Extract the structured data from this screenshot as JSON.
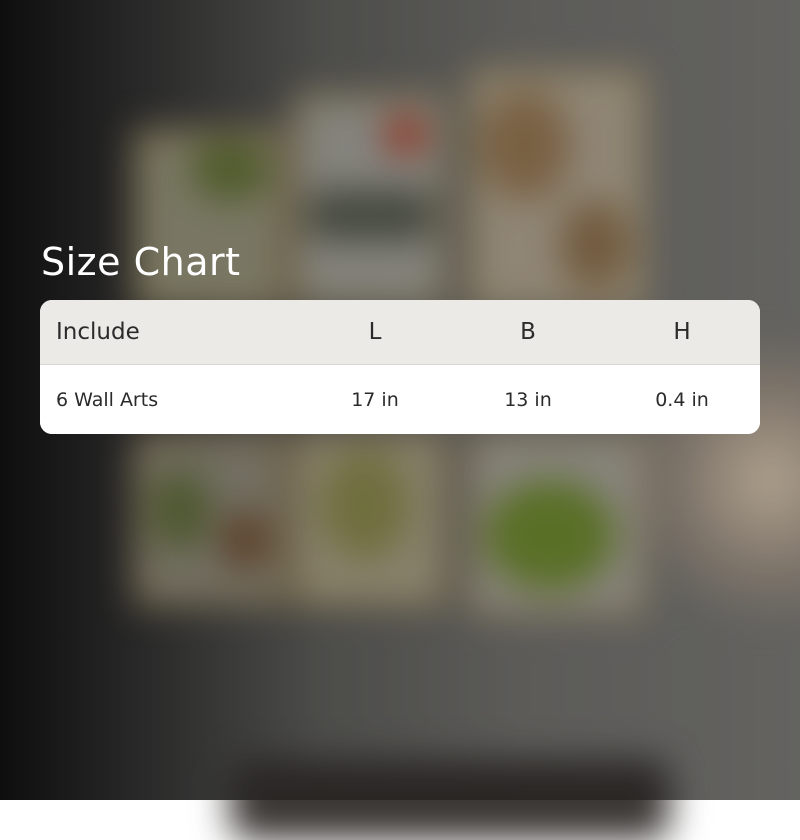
{
  "title": "Size Chart",
  "table": {
    "headers": [
      "Include",
      "L",
      "B",
      "H"
    ],
    "rows": [
      [
        "6 Wall Arts",
        "17 in",
        "13 in",
        "0.4 in"
      ]
    ]
  },
  "colors": {
    "header_bg": "#eceae6",
    "row_bg": "#ffffff",
    "text": "#2b2b2b",
    "title": "#ffffff"
  }
}
